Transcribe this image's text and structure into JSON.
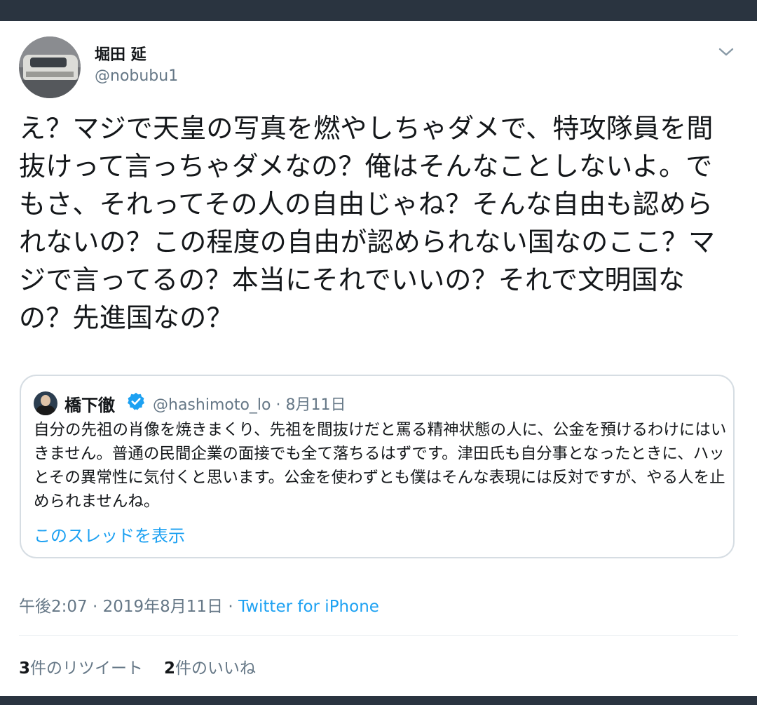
{
  "tweet": {
    "author_name": "堀田 延",
    "author_handle": "@nobubu1",
    "text": "え？マジで天皇の写真を燃やしちゃダメで、特攻隊員を間抜けって言っちゃダメなの？俺はそんなことしないよ。でもさ、それってその人の自由じゃね？そんな自由も認められないの？この程度の自由が認められない国なのここ？マジで言ってるの？本当にそれでいいの？それで文明国なの？先進国なの？",
    "time": "午後2:07",
    "sep1": "·",
    "date": "2019年8月11日",
    "sep2": "·",
    "source": "Twitter for iPhone",
    "retweet_count": "3",
    "retweet_label": "件のリツイート",
    "like_count": "2",
    "like_label": "件のいいね"
  },
  "quoted": {
    "author_name": "橋下徹",
    "author_handle": "@hashimoto_lo",
    "sep": "·",
    "date": "8月11日",
    "text": "自分の先祖の肖像を焼きまくり、先祖を間抜けだと罵る精神状態の人に、公金を預けるわけにはいきません。普通の民間企業の面接でも全て落ちるはずです。津田氏も自分事となったときに、ハッとその異常性に気付くと思います。公金を使わずとも僕はそんな表現には反対ですが、やる人を止められませんね。",
    "show_thread": "このスレッドを表示"
  },
  "icons": {
    "caret": "chevron-down-icon",
    "verified": "verified-badge-icon"
  },
  "colors": {
    "link": "#1da1f2",
    "secondary_text": "#657786",
    "frame": "#2a3440"
  }
}
